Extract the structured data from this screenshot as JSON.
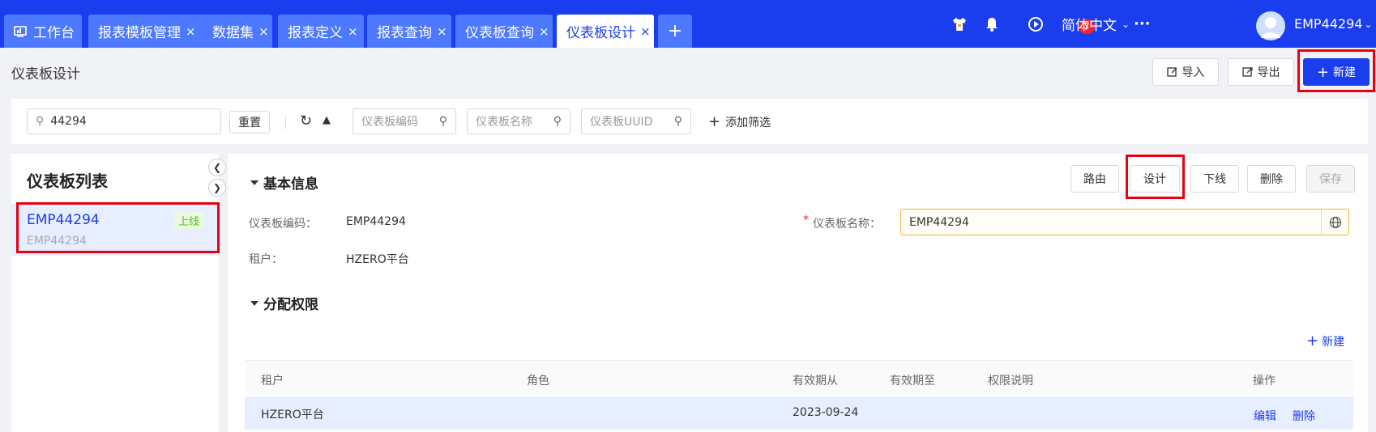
{
  "tabs": [
    {
      "label": "工作台",
      "close": ""
    },
    {
      "label": "报表模板管理",
      "close": "×"
    },
    {
      "label": "数据集",
      "close": "×"
    },
    {
      "label": "报表定义",
      "close": "×"
    },
    {
      "label": "报表查询",
      "close": "×"
    },
    {
      "label": "仪表板查询",
      "close": "×"
    },
    {
      "label": "仪表板设计",
      "close": "×"
    }
  ],
  "add_tab": "+",
  "header": {
    "notification_count": "7",
    "language": "简体中文",
    "more": "···",
    "username": "EMP44294"
  },
  "page": {
    "title": "仪表板设计",
    "import_label": "导入",
    "export_label": "导出",
    "new_label": "新建"
  },
  "filters": {
    "search_value": "44294",
    "reset_label": "重置",
    "code_placeholder": "仪表板编码",
    "name_placeholder": "仪表板名称",
    "uuid_placeholder": "仪表板UUID",
    "add_filter_label": "添加筛选"
  },
  "list": {
    "title": "仪表板列表",
    "items": [
      {
        "name": "EMP44294",
        "code": "EMP44294",
        "status": "上线"
      }
    ]
  },
  "basic": {
    "title": "基本信息",
    "actions": {
      "route": "路由",
      "design": "设计",
      "offline": "下线",
      "delete": "删除",
      "save": "保存"
    },
    "code_label": "仪表板编码：",
    "code_value": "EMP44294",
    "name_label": "仪表板名称：",
    "required_mark": "*",
    "name_value": "EMP44294",
    "tenant_label": "租户：",
    "tenant_value": "HZERO平台"
  },
  "permissions": {
    "title": "分配权限",
    "new_label": "新建",
    "columns": [
      "租户",
      "角色",
      "有效期从",
      "有效期至",
      "权限说明",
      "操作"
    ],
    "rows": [
      {
        "tenant": "HZERO平台",
        "role": "",
        "from": "2023-09-24",
        "to": "",
        "desc": "",
        "edit": "编辑",
        "delete": "删除"
      }
    ]
  },
  "colors": {
    "brand": "#1a3dee",
    "tab_inactive": "#4d79ff",
    "highlight": "#e60012",
    "row_bg": "#e6eeff",
    "online_green": "#52c41a"
  }
}
